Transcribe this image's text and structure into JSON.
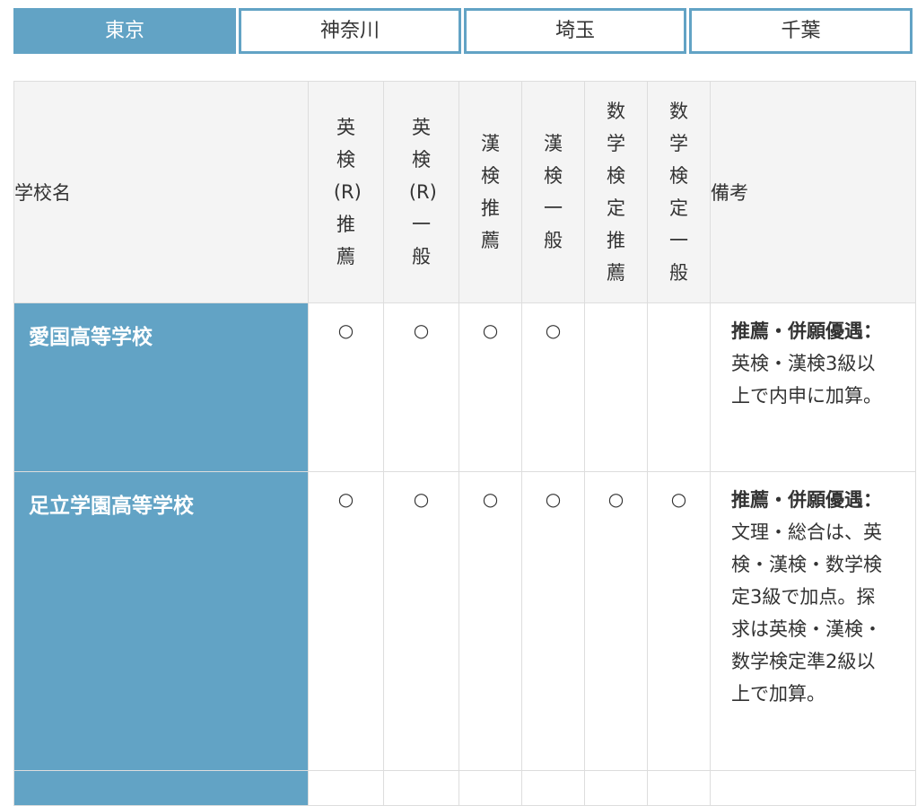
{
  "tabs": [
    {
      "label": "東京",
      "active": true
    },
    {
      "label": "神奈川",
      "active": false
    },
    {
      "label": "埼玉",
      "active": false
    },
    {
      "label": "千葉",
      "active": false
    }
  ],
  "table": {
    "headers": {
      "school_name": "学校名",
      "eiken_r_suisen": "英検(R)推薦",
      "eiken_r_ippan": "英検(R)一般",
      "kanken_suisen": "漢検推薦",
      "kanken_ippan": "漢検一般",
      "suugaku_suisen": "数学検定推薦",
      "suugaku_ippan": "数学検定一般",
      "notes": "備考"
    },
    "rows": [
      {
        "school": "愛国高等学校",
        "marks": [
          "○",
          "○",
          "○",
          "○",
          "",
          ""
        ],
        "note_label": "推薦・併願優遇：",
        "note_text": "英検・漢検3級以上で内申に加算。"
      },
      {
        "school": "足立学園高等学校",
        "marks": [
          "○",
          "○",
          "○",
          "○",
          "○",
          "○"
        ],
        "note_label": "推薦・併願優遇：",
        "note_text": "文理・総合は、英検・漢検・数学検定3級で加点。探求は英検・漢検・数学検定準2級以上で加算。"
      }
    ]
  }
}
